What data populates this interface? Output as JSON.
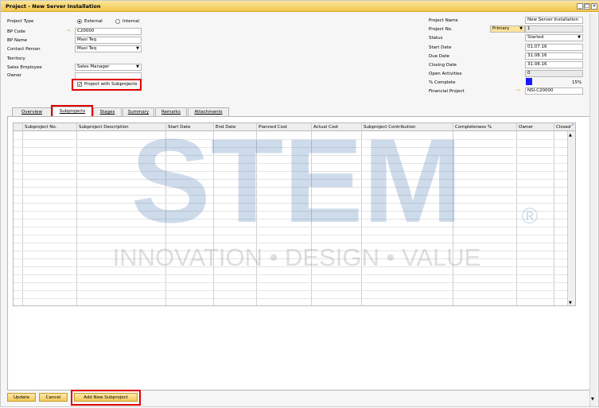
{
  "window": {
    "title": "Project - New Server Installation"
  },
  "left": {
    "project_type_label": "Project Type",
    "external_label": "External",
    "internal_label": "Internal",
    "bp_code_label": "BP Code",
    "bp_code": "C20000",
    "bp_name_label": "BP Name",
    "bp_name": "Maxi Teq",
    "contact_label": "Contact Person",
    "contact": "Maxi Teq",
    "territory_label": "Territory",
    "sales_employee_label": "Sales Employee",
    "sales_employee": "Sales Manager",
    "owner_label": "Owner",
    "subprojects_label": "Project with Subprojects"
  },
  "right": {
    "project_name_label": "Project Name",
    "project_name": "New Server Installation",
    "project_no_label": "Project No.",
    "series": "Primary",
    "project_no": "1",
    "status_label": "Status",
    "status": "Started",
    "start_label": "Start Date",
    "start": "01.07.16",
    "due_label": "Due Date",
    "due": "31.08.16",
    "closing_label": "Closing Date",
    "closing": "31.08.16",
    "open_label": "Open Activities",
    "open": "0",
    "complete_label": "% Complete",
    "complete": "15%",
    "complete_value": 15,
    "financial_label": "Financial Project",
    "financial": "NSI-C20000"
  },
  "tabs": [
    "Overview",
    "Subprojects",
    "Stages",
    "Summary",
    "Remarks",
    "Attachments"
  ],
  "grid": {
    "columns": [
      "Subproject No.",
      "Subproject Description",
      "Start Date",
      "End Date",
      "Planned Cost",
      "Actual Cost",
      "Subproject Contribution",
      "Completeness %",
      "Owner",
      "Closed"
    ]
  },
  "buttons": {
    "update": "Update",
    "cancel": "Cancel",
    "add": "Add New Subproject"
  },
  "watermark": {
    "brand": "STEM",
    "tagline": "INNOVATION • DESIGN • VALUE",
    "reg": "®"
  },
  "colors": {
    "accent": "#f5c95c",
    "highlight": "#e00000",
    "progress": "#1a1aff"
  }
}
